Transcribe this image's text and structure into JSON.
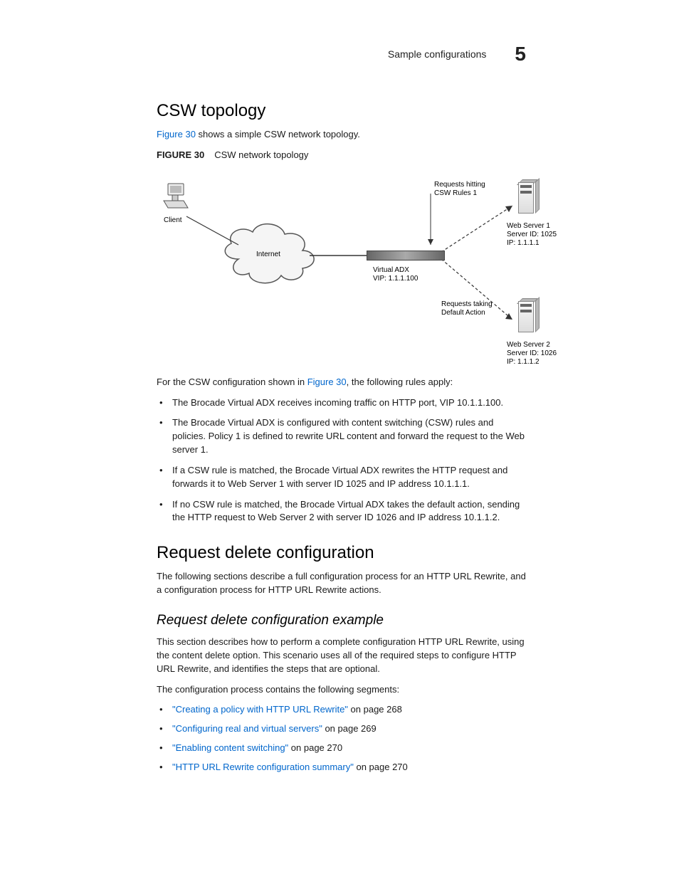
{
  "header": {
    "section_title": "Sample configurations",
    "chapter_number": "5"
  },
  "section1": {
    "heading": "CSW topology",
    "intro_pre": "",
    "intro_link": "Figure 30",
    "intro_post": " shows a simple CSW network topology.",
    "fig_num": "FIGURE 30",
    "fig_title": "CSW network topology",
    "diagram": {
      "client": "Client",
      "internet": "Internet",
      "adx1": "Virtual ADX",
      "adx2": "VIP: 1.1.1.100",
      "rule_top1": "Requests hitting",
      "rule_top2": "CSW Rules 1",
      "ws1a": "Web Server 1",
      "ws1b": "Server ID: 1025",
      "ws1c": "IP: 1.1.1.1",
      "rule_bot1": "Requests taking",
      "rule_bot2": "Default Action",
      "ws2a": "Web Server 2",
      "ws2b": "Server ID: 1026",
      "ws2c": "IP: 1.1.1.2"
    },
    "rules_intro_pre": "For the CSW configuration shown in ",
    "rules_intro_link": "Figure 30",
    "rules_intro_post": ", the following rules apply:",
    "bullets": [
      "The Brocade Virtual ADX receives incoming traffic on HTTP port, VIP 10.1.1.100.",
      "The Brocade Virtual ADX is configured with content switching (CSW) rules and policies. Policy 1 is defined to rewrite URL content and forward the request to the Web server 1.",
      "If a CSW rule is matched, the Brocade Virtual ADX rewrites the HTTP request and forwards it to Web Server 1 with server ID 1025 and IP address 10.1.1.1.",
      "If no CSW rule is matched, the Brocade Virtual ADX takes the default action, sending the HTTP request to Web Server 2 with server ID 1026 and IP address 10.1.1.2."
    ]
  },
  "section2": {
    "heading": "Request delete configuration",
    "intro": "The following sections describe a full configuration process for an HTTP URL Rewrite, and a configuration process for HTTP URL Rewrite actions.",
    "sub_heading": "Request delete configuration example",
    "sub_para": "This section describes how to perform a complete configuration HTTP URL Rewrite, using the content delete option. This scenario uses all of the required steps to configure HTTP URL Rewrite, and identifies the steps that are optional.",
    "seg_intro": "The configuration process contains the following segments:",
    "links": [
      {
        "text": "\"Creating a policy with HTTP URL Rewrite\"",
        "page": " on page 268"
      },
      {
        "text": "\"Configuring real and virtual servers\"",
        "page": " on page 269"
      },
      {
        "text": "\"Enabling content switching\"",
        "page": " on page 270"
      },
      {
        "text": "\"HTTP URL Rewrite configuration summary\"",
        "page": " on page 270"
      }
    ]
  }
}
